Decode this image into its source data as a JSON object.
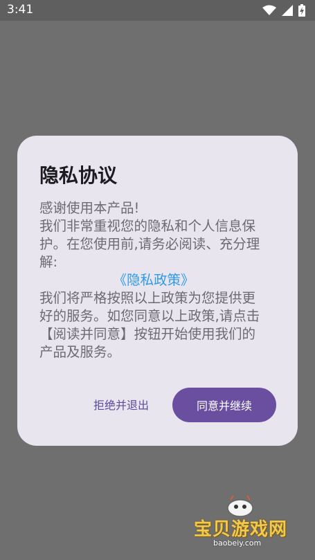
{
  "status_bar": {
    "time": "3:41",
    "icons": [
      "wifi-icon",
      "cellular-signal-icon",
      "battery-charging-icon"
    ]
  },
  "dialog": {
    "title": "隐私协议",
    "body": {
      "line1": "感谢使用本产品!",
      "line2": "我们非常重视您的隐私和个人信息保护。在您使用前,请务必阅读、充分理解:",
      "policy_link": "《隐私政策》",
      "line3": "我们将严格按照以上政策为您提供更好的服务。如您同意以上政策,请点击【阅读并同意】按钮开始使用我们的产品及服务。"
    },
    "decline_label": "拒绝并退出",
    "accept_label": "同意并继续"
  },
  "watermark": {
    "text": "宝贝游戏网",
    "url": "baobeiy.com"
  },
  "colors": {
    "accent": "#6a4fa1",
    "link": "#2f9be4",
    "dialog_bg": "#e8e5ef",
    "scrim": "#6f6f6f"
  }
}
